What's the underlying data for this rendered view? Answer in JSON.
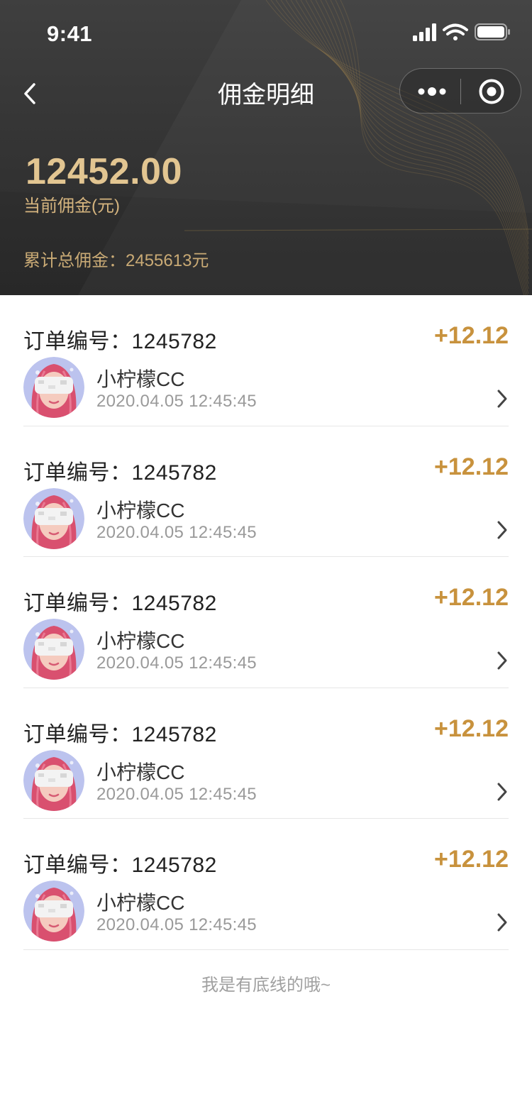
{
  "status_bar": {
    "time": "9:41",
    "icons": [
      "signal-icon",
      "wifi-icon",
      "battery-icon"
    ]
  },
  "nav": {
    "back_icon": "chevron-left-icon",
    "title": "佣金明细",
    "capsule_icons": [
      "more-dots-icon",
      "target-icon"
    ]
  },
  "summary": {
    "current_commission": "12452.00",
    "current_label": "当前佣金(元)",
    "total_text": "累计总佣金：2455613元"
  },
  "orders": [
    {
      "order_label": "订单编号：1245782",
      "amount": "+12.12",
      "user_name": "小柠檬CC",
      "time": "2020.04.05 12:45:45"
    },
    {
      "order_label": "订单编号：1245782",
      "amount": "+12.12",
      "user_name": "小柠檬CC",
      "time": "2020.04.05 12:45:45"
    },
    {
      "order_label": "订单编号：1245782",
      "amount": "+12.12",
      "user_name": "小柠檬CC",
      "time": "2020.04.05 12:45:45"
    },
    {
      "order_label": "订单编号：1245782",
      "amount": "+12.12",
      "user_name": "小柠檬CC",
      "time": "2020.04.05 12:45:45"
    },
    {
      "order_label": "订单编号：1245782",
      "amount": "+12.12",
      "user_name": "小柠檬CC",
      "time": "2020.04.05 12:45:45"
    }
  ],
  "footer": {
    "text": "我是有底线的哦~"
  },
  "colors": {
    "header_bg": "#333333",
    "gold": "#e2c591",
    "amount": "#c8923d",
    "divider": "#e6e6e6"
  }
}
